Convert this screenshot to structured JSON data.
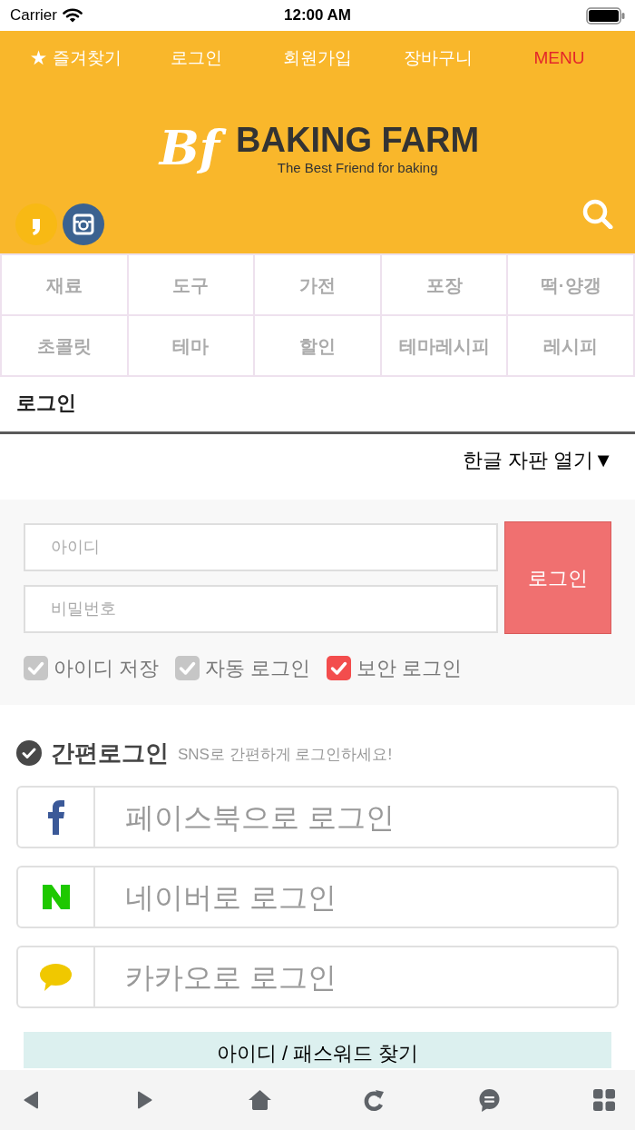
{
  "status_bar": {
    "carrier": "Carrier",
    "time": "12:00 AM"
  },
  "header": {
    "links": [
      {
        "label": "★ 즐겨찾기",
        "kind": "link"
      },
      {
        "label": "로그인",
        "kind": "link"
      },
      {
        "label": "회원가입",
        "kind": "link"
      },
      {
        "label": "장바구니",
        "kind": "link"
      },
      {
        "label": "MENU",
        "kind": "menu"
      }
    ],
    "logo": {
      "mark": "Bf",
      "name": "BAKING FARM",
      "tagline": "The Best Friend for baking"
    },
    "social": [
      {
        "kind": "kakaostory"
      },
      {
        "kind": "instagram"
      }
    ]
  },
  "categories": [
    "재료",
    "도구",
    "가전",
    "포장",
    "떡·양갱",
    "초콜릿",
    "테마",
    "할인",
    "테마레시피",
    "레시피"
  ],
  "page_title": "로그인",
  "keyboard_toggle": "한글 자판 열기▼",
  "login_form": {
    "id_placeholder": "아이디",
    "password_placeholder": "비밀번호",
    "submit": "로그인",
    "options": [
      {
        "label": "아이디 저장",
        "checked": false
      },
      {
        "label": "자동 로그인",
        "checked": false
      },
      {
        "label": "보안 로그인",
        "checked": true
      }
    ]
  },
  "easy_login": {
    "title": "간편로그인",
    "subtitle": "SNS로 간편하게 로그인하세요!",
    "providers": [
      {
        "label": "페이스북으로 로그인",
        "kind": "facebook"
      },
      {
        "label": "네이버로 로그인",
        "kind": "naver"
      },
      {
        "label": "카카오로 로그인",
        "kind": "kakao"
      }
    ]
  },
  "find_account": "아이디 / 패스워드 찾기",
  "toolbar": [
    {
      "kind": "back"
    },
    {
      "kind": "forward"
    },
    {
      "kind": "home"
    },
    {
      "kind": "refresh"
    },
    {
      "kind": "chat"
    },
    {
      "kind": "apps"
    }
  ]
}
